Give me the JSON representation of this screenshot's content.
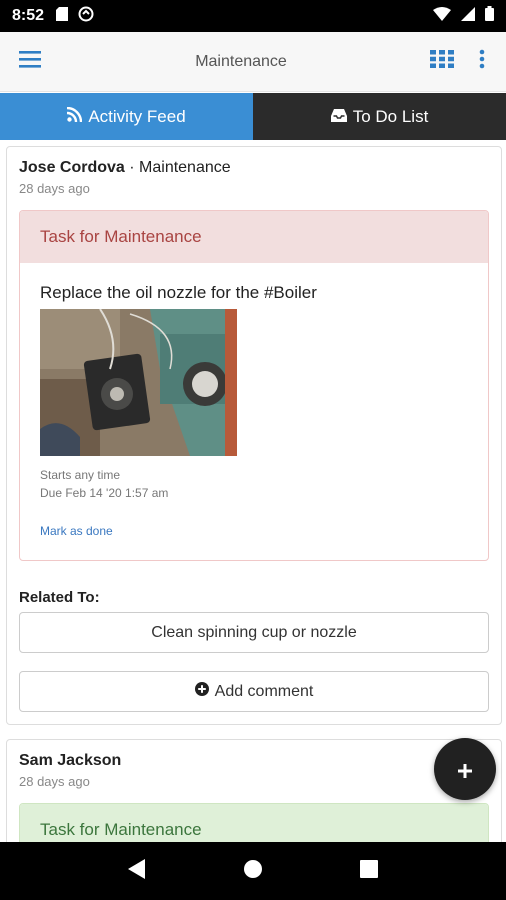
{
  "status_bar": {
    "time": "8:52"
  },
  "app_bar": {
    "title": "Maintenance"
  },
  "tabs": [
    {
      "label": "Activity Feed",
      "icon": "rss-icon",
      "active": true
    },
    {
      "label": "To Do List",
      "icon": "inbox-icon",
      "active": false
    }
  ],
  "feed": {
    "posts": [
      {
        "author": "Jose Cordova",
        "separator": " · ",
        "group": "Maintenance",
        "time_ago": "28 days ago",
        "task": {
          "header": "Task for Maintenance",
          "title": "Replace the oil nozzle for the #Boiler",
          "starts": "Starts any time",
          "due": "Due Feb 14 '20 1:57 am",
          "mark_done": "Mark as done"
        },
        "related_label": "Related To:",
        "related_item": "Clean spinning cup or nozzle",
        "add_comment": "Add comment"
      },
      {
        "author": "Sam Jackson",
        "time_ago": "28 days ago",
        "task": {
          "header": "Task for Maintenance"
        }
      }
    ]
  },
  "colors": {
    "accent": "#3a8ed4",
    "tab_inactive": "#2b2b2b",
    "task_danger_bg": "#f2dede",
    "task_success_bg": "#dff0d8",
    "link": "#3a78c0"
  },
  "fab": {
    "icon": "plus-icon"
  }
}
